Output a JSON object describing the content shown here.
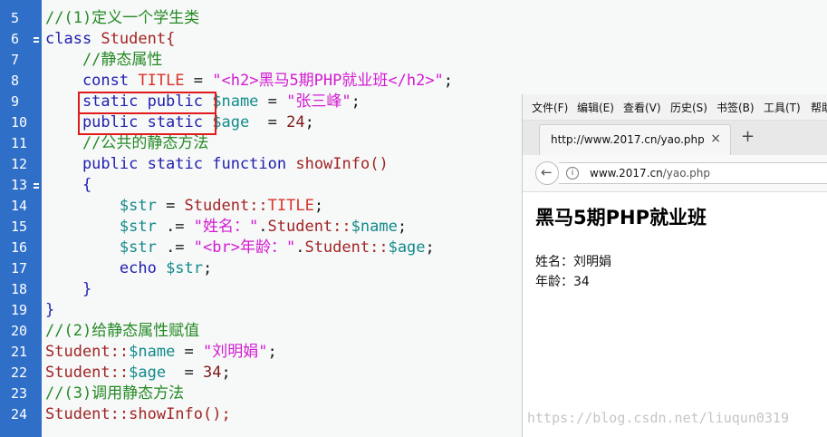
{
  "editor": {
    "line_numbers": [
      "5",
      "6",
      "7",
      "8",
      "9",
      "10",
      "11",
      "12",
      "13",
      "14",
      "15",
      "16",
      "17",
      "18",
      "19",
      "20",
      "21",
      "22",
      "23",
      "24"
    ],
    "lines": [
      [
        {
          "t": "//(1)定义一个学生类",
          "c": "comment"
        }
      ],
      [
        {
          "t": "class ",
          "c": "kw"
        },
        {
          "t": "Student{",
          "c": "cls"
        }
      ],
      [
        {
          "t": "    //静态属性",
          "c": "comment"
        }
      ],
      [
        {
          "t": "    const ",
          "c": "kw"
        },
        {
          "t": "TITLE",
          "c": "const"
        },
        {
          "t": " = ",
          "c": "plain"
        },
        {
          "t": "\"<h2>黑马5期PHP就业班</h2>\"",
          "c": "str"
        },
        {
          "t": ";",
          "c": "plain"
        }
      ],
      [
        {
          "t": "    static public ",
          "c": "kw"
        },
        {
          "t": "$name",
          "c": "var"
        },
        {
          "t": " = ",
          "c": "plain"
        },
        {
          "t": "\"张三峰\"",
          "c": "str"
        },
        {
          "t": ";",
          "c": "plain"
        }
      ],
      [
        {
          "t": "    public static ",
          "c": "kw"
        },
        {
          "t": "$age",
          "c": "var"
        },
        {
          "t": "  = ",
          "c": "plain"
        },
        {
          "t": "24",
          "c": "num"
        },
        {
          "t": ";",
          "c": "plain"
        }
      ],
      [
        {
          "t": "    //公共的静态方法",
          "c": "comment"
        }
      ],
      [
        {
          "t": "    public static function ",
          "c": "kw"
        },
        {
          "t": "showInfo()",
          "c": "cls"
        }
      ],
      [
        {
          "t": "    {",
          "c": "kw"
        }
      ],
      [
        {
          "t": "        $str",
          "c": "var"
        },
        {
          "t": " = ",
          "c": "plain"
        },
        {
          "t": "Student::",
          "c": "cls"
        },
        {
          "t": "TITLE",
          "c": "const"
        },
        {
          "t": ";",
          "c": "plain"
        }
      ],
      [
        {
          "t": "        $str",
          "c": "var"
        },
        {
          "t": " .= ",
          "c": "plain"
        },
        {
          "t": "\"姓名：\"",
          "c": "str"
        },
        {
          "t": ".",
          "c": "plain"
        },
        {
          "t": "Student::",
          "c": "cls"
        },
        {
          "t": "$name",
          "c": "var"
        },
        {
          "t": ";",
          "c": "plain"
        }
      ],
      [
        {
          "t": "        $str",
          "c": "var"
        },
        {
          "t": " .= ",
          "c": "plain"
        },
        {
          "t": "\"<br>年龄：\"",
          "c": "str"
        },
        {
          "t": ".",
          "c": "plain"
        },
        {
          "t": "Student::",
          "c": "cls"
        },
        {
          "t": "$age",
          "c": "var"
        },
        {
          "t": ";",
          "c": "plain"
        }
      ],
      [
        {
          "t": "        echo ",
          "c": "kw"
        },
        {
          "t": "$str",
          "c": "var"
        },
        {
          "t": ";",
          "c": "plain"
        }
      ],
      [
        {
          "t": "    }",
          "c": "kw"
        }
      ],
      [
        {
          "t": "}",
          "c": "kw"
        }
      ],
      [
        {
          "t": "//(2)给静态属性赋值",
          "c": "comment"
        }
      ],
      [
        {
          "t": "Student::",
          "c": "cls"
        },
        {
          "t": "$name",
          "c": "var"
        },
        {
          "t": " = ",
          "c": "plain"
        },
        {
          "t": "\"刘明娟\"",
          "c": "str"
        },
        {
          "t": ";",
          "c": "plain"
        }
      ],
      [
        {
          "t": "Student::",
          "c": "cls"
        },
        {
          "t": "$age",
          "c": "var"
        },
        {
          "t": "  = ",
          "c": "plain"
        },
        {
          "t": "34",
          "c": "num"
        },
        {
          "t": ";",
          "c": "plain"
        }
      ],
      [
        {
          "t": "//(3)调用静态方法",
          "c": "comment"
        }
      ],
      [
        {
          "t": "Student::",
          "c": "cls"
        },
        {
          "t": "showInfo();",
          "c": "cls"
        }
      ]
    ],
    "fold_lines": [
      "6",
      "13"
    ]
  },
  "browser": {
    "menu": [
      "文件(F)",
      "编辑(E)",
      "查看(V)",
      "历史(S)",
      "书签(B)",
      "工具(T)",
      "帮助"
    ],
    "tab_title": "http://www.2017.cn/yao.php",
    "tab_close": "×",
    "new_tab": "+",
    "back_arrow": "←",
    "info_icon": "i",
    "url_host": "www.2017.cn",
    "url_path": "/yao.php",
    "page_heading": "黑马5期PHP就业班",
    "page_line1": "姓名：刘明娟",
    "page_line2": "年龄：34"
  },
  "watermark": "https://blog.csdn.net/liuqun0319",
  "colors": {
    "gutter": "#2f6fc8",
    "keyword": "#1f1fae",
    "comment": "#258a25",
    "string": "#d21bd2",
    "highlight_box": "#e11b1b"
  }
}
